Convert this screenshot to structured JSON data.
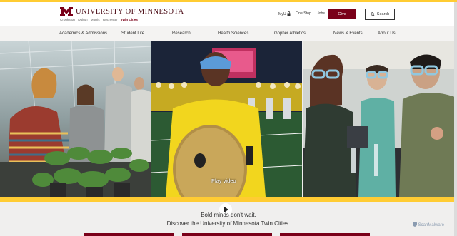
{
  "header": {
    "logo_text": "UNIVERSITY OF MINNESOTA",
    "campuses": [
      "Crookston",
      "Duluth",
      "Morris",
      "Rochester",
      "Twin Cities"
    ],
    "active_campus": "Twin Cities",
    "util_links": [
      "MyU",
      "One Stop",
      "Jobs"
    ],
    "give_label": "Give",
    "search_label": "Search"
  },
  "nav": {
    "items": [
      "Academics & Admissions",
      "Student Life",
      "Research",
      "Health Sciences",
      "Gopher Athletics",
      "News & Events",
      "About Us"
    ]
  },
  "hero": {
    "play_label": "Play video"
  },
  "tagline": {
    "line1": "Bold minds don't wait.",
    "line2": "Discover the University of Minnesota Twin Cities."
  },
  "watermark": "ScanMalware",
  "colors": {
    "maroon": "#7a0019",
    "gold": "#ffcc33"
  }
}
